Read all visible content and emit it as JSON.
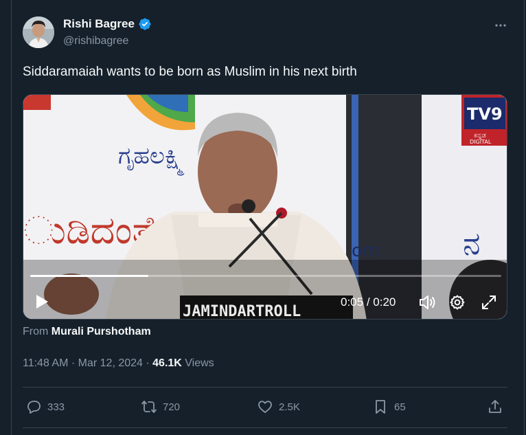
{
  "author": {
    "name": "Rishi Bagree",
    "handle": "@rishibagree",
    "verified": true
  },
  "tweet": {
    "text": "Siddaramaiah wants to be born as Muslim in his next birth"
  },
  "video": {
    "current_time": "0:05",
    "duration": "0:20",
    "time_separator": " / ",
    "progress_fraction": 0.25,
    "overlay_texts": {
      "kannada_top": "ಗೃಹಲಕ್ಷ್ಮಿ",
      "kannada_mid": "ುಡಿದಂತೆ ನ",
      "watermark": "JAMINDARTROLL",
      "channel": "TV9",
      "channel_sub": "ಕನ್ನಡ",
      "channel_digital": "DIGITAL",
      "url_fragment": "om"
    }
  },
  "source": {
    "prefix": "From",
    "name": "Murali Purshotham"
  },
  "meta": {
    "time": "11:48 AM",
    "date": "Mar 12, 2024",
    "views_count": "46.1K",
    "views_label": "Views",
    "separator": " · "
  },
  "actions": {
    "replies": "333",
    "reposts": "720",
    "likes": "2.5K",
    "bookmarks": "65"
  },
  "colors": {
    "background": "#15202b",
    "text_primary": "#f7f9f9",
    "text_secondary": "#8b98a5",
    "verified_blue": "#1d9bf0",
    "border": "#38444d"
  }
}
